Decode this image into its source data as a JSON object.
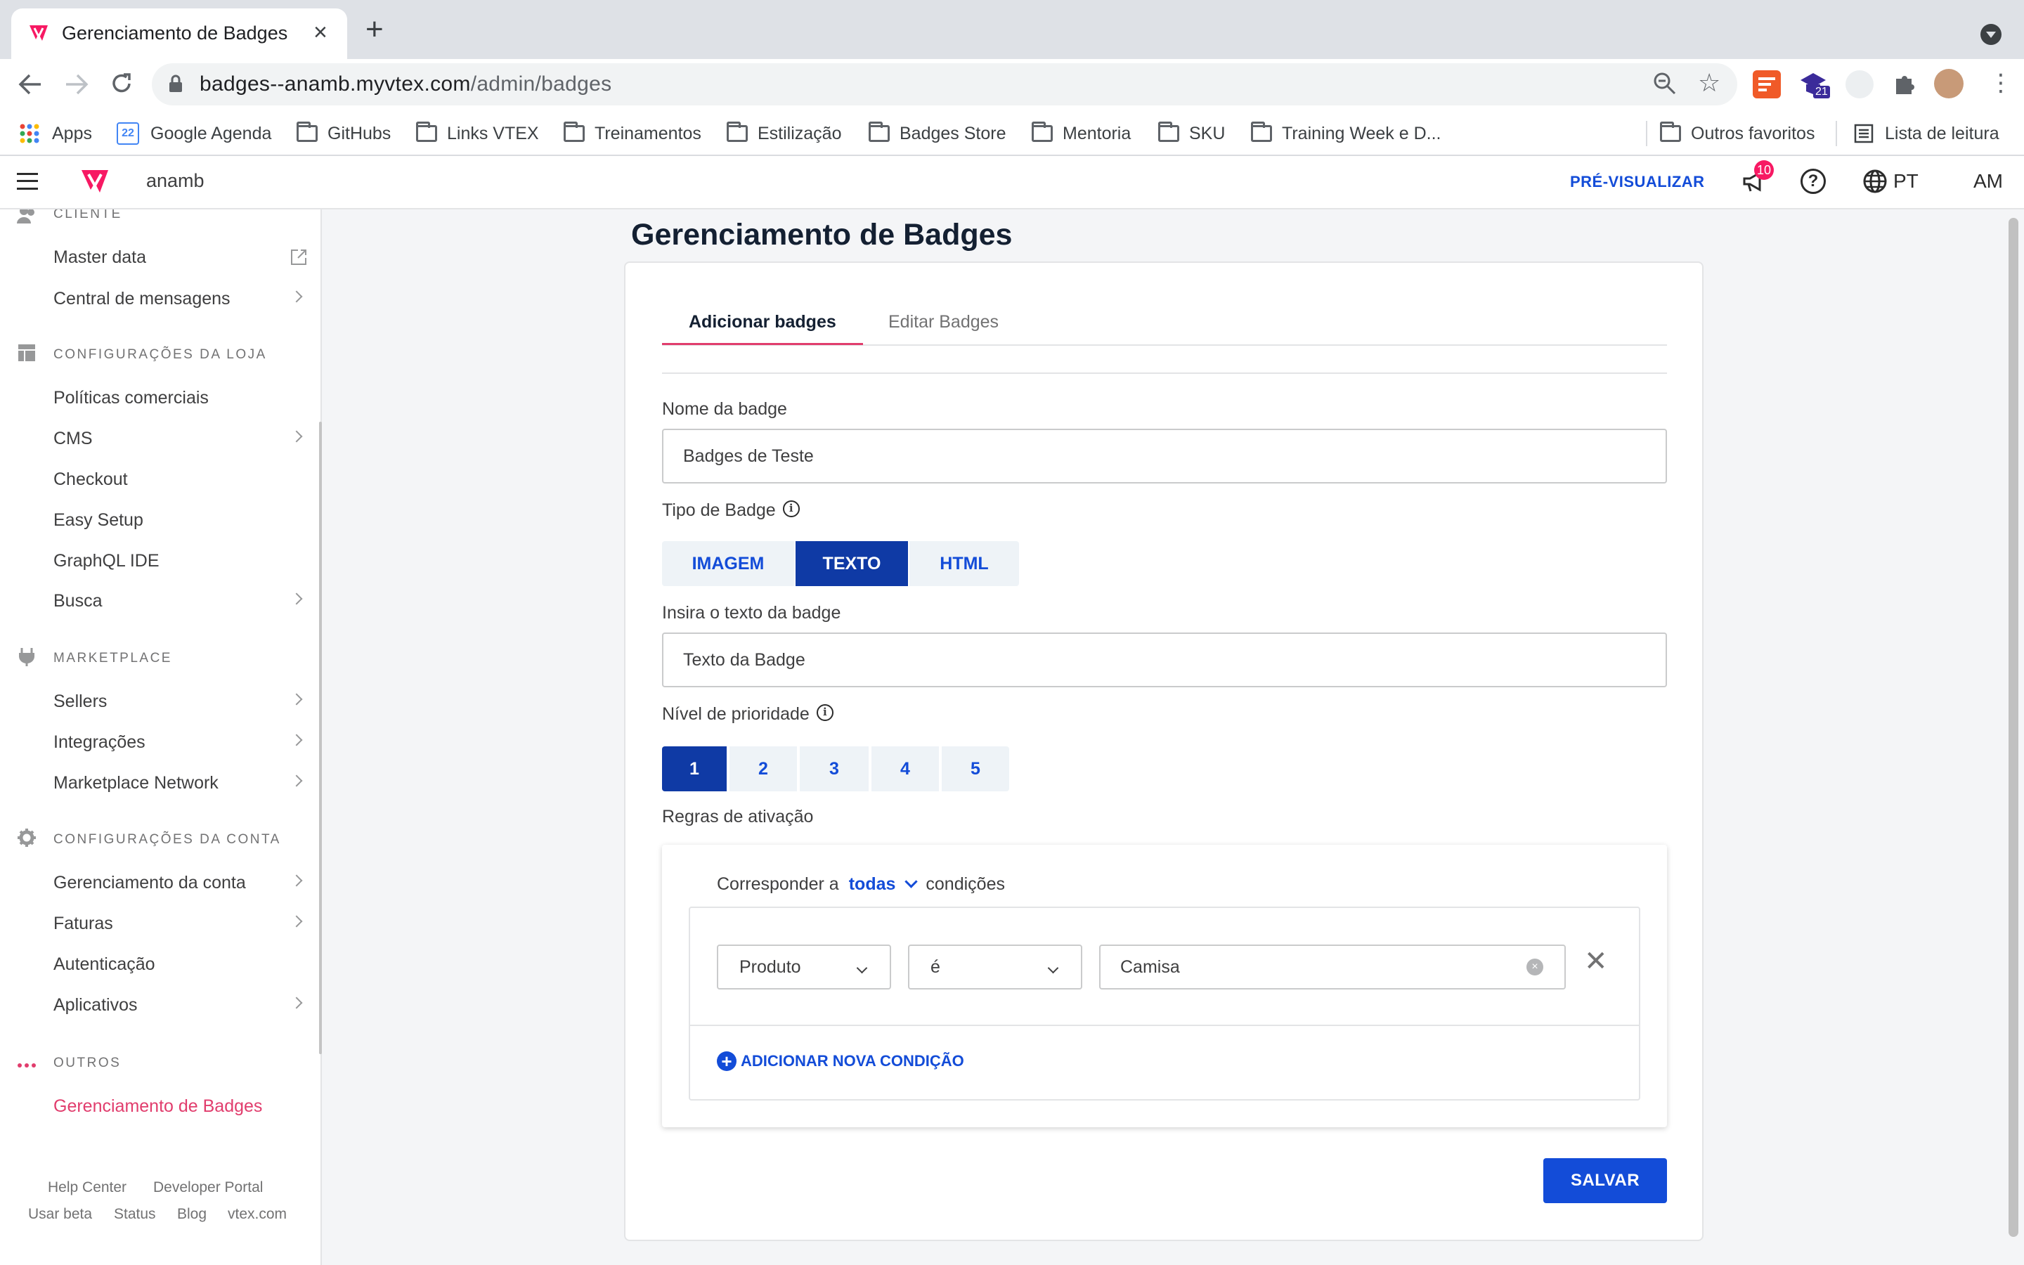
{
  "browser": {
    "tab_title": "Gerenciamento de Badges",
    "url_host": "badges--anamb.myvtex.com",
    "url_path": "/admin/badges",
    "extension_badge": "21",
    "bookmarks": [
      {
        "label": "Apps",
        "icon": "apps-grid-icon"
      },
      {
        "label": "Google Agenda",
        "icon": "calendar-icon",
        "icon_text": "22"
      },
      {
        "label": "GitHubs",
        "icon": "folder-icon"
      },
      {
        "label": "Links VTEX",
        "icon": "folder-icon"
      },
      {
        "label": "Treinamentos",
        "icon": "folder-icon"
      },
      {
        "label": "Estilização",
        "icon": "folder-icon"
      },
      {
        "label": "Badges Store",
        "icon": "folder-icon"
      },
      {
        "label": "Mentoria",
        "icon": "folder-icon"
      },
      {
        "label": "SKU",
        "icon": "folder-icon"
      },
      {
        "label": "Training Week e D...",
        "icon": "folder-icon"
      }
    ],
    "other_bookmarks": "Outros favoritos",
    "reading_list": "Lista de leitura"
  },
  "topbar": {
    "account": "anamb",
    "preview": "PRÉ-VISUALIZAR",
    "notifications": "10",
    "language": "PT",
    "user_initials": "AM"
  },
  "sidebar": {
    "sections": [
      {
        "title": "CLIENTE",
        "icon": "users-icon",
        "items": [
          {
            "label": "Master data",
            "icon": "external-link-icon"
          },
          {
            "label": "Central de mensagens",
            "chevron": true
          }
        ]
      },
      {
        "title": "CONFIGURAÇÕES DA LOJA",
        "icon": "layout-icon",
        "items": [
          {
            "label": "Políticas comerciais"
          },
          {
            "label": "CMS",
            "chevron": true
          },
          {
            "label": "Checkout"
          },
          {
            "label": "Easy Setup"
          },
          {
            "label": "GraphQL IDE"
          },
          {
            "label": "Busca",
            "chevron": true
          }
        ]
      },
      {
        "title": "MARKETPLACE",
        "icon": "plug-icon",
        "items": [
          {
            "label": "Sellers",
            "chevron": true
          },
          {
            "label": "Integrações",
            "chevron": true
          },
          {
            "label": "Marketplace Network",
            "chevron": true
          }
        ]
      },
      {
        "title": "CONFIGURAÇÕES DA CONTA",
        "icon": "gear-icon",
        "items": [
          {
            "label": "Gerenciamento da conta",
            "chevron": true
          },
          {
            "label": "Faturas",
            "chevron": true
          },
          {
            "label": "Autenticação"
          },
          {
            "label": "Aplicativos",
            "chevron": true
          }
        ]
      },
      {
        "title": "OUTROS",
        "icon": "dots-icon",
        "items": [
          {
            "label": "Gerenciamento de Badges",
            "active": true
          }
        ]
      }
    ],
    "footer": [
      "Help Center",
      "Developer Portal",
      "Usar beta",
      "Status",
      "Blog",
      "vtex.com"
    ]
  },
  "main": {
    "title": "Gerenciamento de Badges",
    "tabs": [
      "Adicionar badges",
      "Editar Badges"
    ],
    "active_tab": "Adicionar badges",
    "name_label": "Nome da badge",
    "name_value": "Badges de Teste",
    "type_label": "Tipo de Badge",
    "type_options": [
      "IMAGEM",
      "TEXTO",
      "HTML"
    ],
    "type_selected": "TEXTO",
    "text_label": "Insira o texto da badge",
    "text_value": "Texto da Badge",
    "priority_label": "Nível de prioridade",
    "priority_options": [
      "1",
      "2",
      "3",
      "4",
      "5"
    ],
    "priority_selected": "1",
    "rules_label": "Regras de ativação",
    "rules": {
      "match_prefix": "Corresponder a",
      "match_value": "todas",
      "match_suffix": "condições",
      "condition": {
        "field": "Produto",
        "operator": "é",
        "value": "Camisa"
      },
      "add_condition": "ADICIONAR NOVA CONDIÇÃO"
    },
    "save": "SALVAR"
  },
  "colors": {
    "primary": "#134cd8",
    "primary_dark": "#0f3aa5",
    "accent": "#e13d6d",
    "badge": "#f71963"
  }
}
